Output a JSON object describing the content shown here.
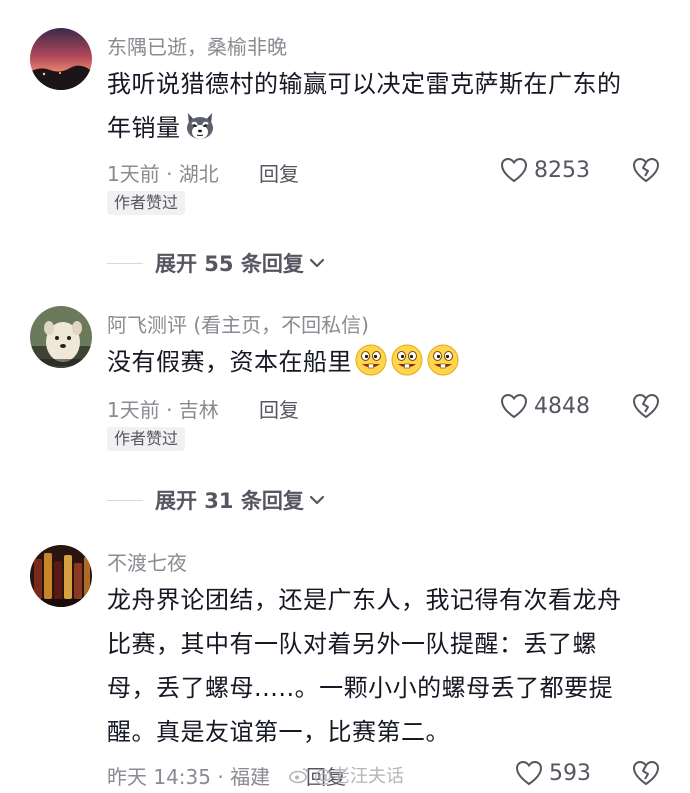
{
  "comments": [
    {
      "username": "东隅已逝，桑榆非晚",
      "text_line1": "我听说猎德村的输赢可以决定雷克萨斯在广东的",
      "text_line2": "年销量",
      "emoji": "husky-emoji",
      "time_location": "1天前 · 湖北",
      "reply_label": "回复",
      "likes": "8253",
      "badge": "作者赞过",
      "expand_label": "展开 55 条回复"
    },
    {
      "username": "阿飞测评 (看主页，不回私信)",
      "text_line1": "没有假赛，资本在船里",
      "emoji": "grinning-teeth-emoji",
      "time_location": "1天前 · 吉林",
      "reply_label": "回复",
      "likes": "4848",
      "badge": "作者赞过",
      "expand_label": "展开 31 条回复"
    },
    {
      "username": "不渡七夜",
      "text_line1": "龙舟界论团结，还是广东人，我记得有次看龙舟",
      "text_line2": "比赛，其中有一队对着另外一队提醒：丢了螺",
      "text_line3": "母，丢了螺母.....。一颗小小的螺母丢了都要提",
      "text_line4": "醒。真是友谊第一，比赛第二。",
      "time_location": "昨天 14:35 · 福建",
      "reply_label": "回复",
      "likes": "593"
    }
  ],
  "watermark": {
    "text": "@老汪夫话"
  },
  "icons": {
    "like": "heart-outline-icon",
    "dislike": "broken-heart-icon",
    "expand": "chevron-down-icon"
  },
  "colors": {
    "primary_text": "#161823",
    "secondary_text": "#8a8b91",
    "action_text": "#555660",
    "badge_bg": "#f1f1f2"
  }
}
